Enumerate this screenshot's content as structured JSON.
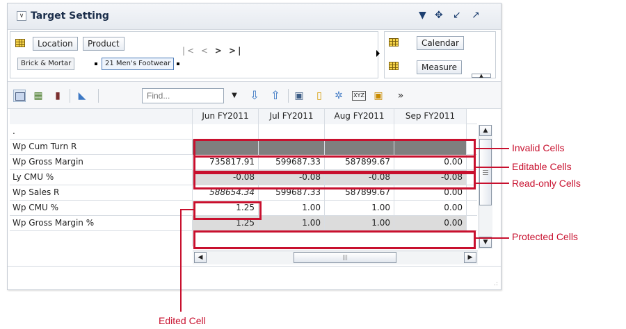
{
  "panel": {
    "title": "Target Setting"
  },
  "dimensions": {
    "row_buttons": [
      "Location",
      "Product"
    ],
    "row_chips": [
      "Brick & Mortar",
      "21 Men's Footwear"
    ],
    "col_buttons": [
      "Calendar",
      "Measure"
    ]
  },
  "toolbar": {
    "find_placeholder": "Find..."
  },
  "table": {
    "columns": [
      "Jun FY2011",
      "Jul FY2011",
      "Aug FY2011",
      "Sep FY2011"
    ],
    "header_row_label": ".",
    "rows": [
      {
        "label": "Wp Cum Turn R",
        "values": [
          "",
          "",
          "",
          ""
        ]
      },
      {
        "label": "Wp Gross Margin",
        "values": [
          "735817.91",
          "599687.33",
          "587899.67",
          "0.00"
        ]
      },
      {
        "label": "Ly CMU %",
        "values": [
          "-0.08",
          "-0.08",
          "-0.08",
          "-0.08"
        ]
      },
      {
        "label": "Wp Sales R",
        "values": [
          "588654.34",
          "599687.33",
          "587899.67",
          "0.00"
        ]
      },
      {
        "label": "Wp CMU %",
        "values": [
          "1.25",
          "1.00",
          "1.00",
          "0.00"
        ]
      },
      {
        "label": "Wp Gross Margin %",
        "values": [
          "1.25",
          "1.00",
          "1.00",
          "0.00"
        ]
      }
    ]
  },
  "callouts": {
    "invalid": "Invalid Cells",
    "editable": "Editable Cells",
    "readonly": "Read-only Cells",
    "protected": "Protected Cells",
    "edited": "Edited Cell"
  },
  "colors": {
    "callout_red": "#c8102e",
    "invalid_gray": "#7f7f7f",
    "readonly_gray": "#dcdcdc"
  }
}
